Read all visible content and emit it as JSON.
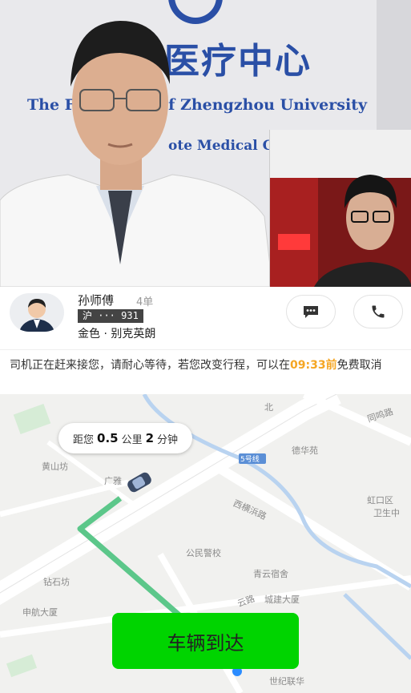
{
  "video": {
    "sign_cn": "医疗中心",
    "sign_en_line1": "The F                  Hospital of Zhengzhou University",
    "sign_en_line2": "ote Medical Cen"
  },
  "driver": {
    "name": "孙师傅",
    "orders": "4单",
    "plate": "沪 ··· 931",
    "car": "金色 · 别克英朗"
  },
  "notice": {
    "text_before": "司机正在赶来接您，请耐心等待，若您改变行程，可以在",
    "time": "09:33前",
    "text_after": "免费取消"
  },
  "eta": {
    "prefix": "距您",
    "distance": "0.5",
    "distance_unit": "公里",
    "minutes": "2",
    "minutes_unit": "分钟"
  },
  "map": {
    "labels": {
      "tongming_road": "同鸣路",
      "dehuayuan": "德华苑",
      "huangshanfang": "黄山坊",
      "guangya": "广雅",
      "xiheng_road": "西横浜路",
      "hongkou": "虹口区",
      "health_center": "卫生中",
      "police_school": "公民警校",
      "qingyun": "青云宿舍",
      "chengjian": "城建大厦",
      "zuanshifang": "钻石坊",
      "shenhang": "申航大厦",
      "yunlu": "云路",
      "shiji": "世纪联华",
      "bei": "北",
      "bus_tag": "5号线"
    }
  },
  "actions": {
    "arrive_label": "车辆到达"
  },
  "colors": {
    "route": "#5cc78a",
    "arrive_button": "#00d400",
    "highlight": "#f5a623"
  }
}
